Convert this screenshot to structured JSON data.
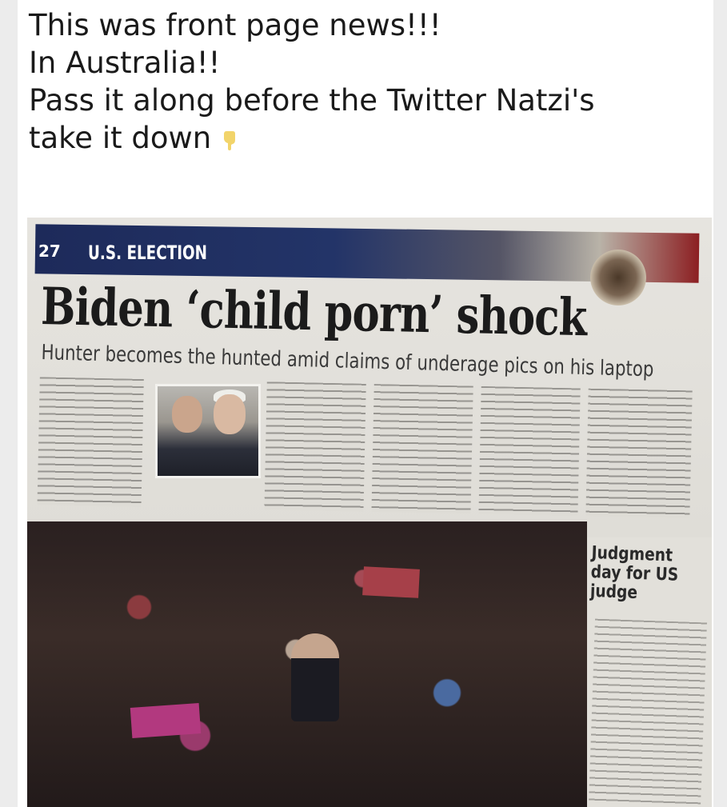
{
  "post": {
    "caption_lines": [
      "This was front page news!!!",
      "In Australia!!",
      "Pass it along before the Twitter Natzi's",
      "take it down"
    ],
    "emoji_icon": "pointing-down-hand-icon"
  },
  "newspaper": {
    "page_number": "27",
    "section": "U.S. ELECTION",
    "headline": "Biden ‘child porn’ shock",
    "subheadline": "Hunter becomes the hunted amid claims of underage pics on his laptop",
    "sidebar_headline": "Judgment day for US judge"
  }
}
